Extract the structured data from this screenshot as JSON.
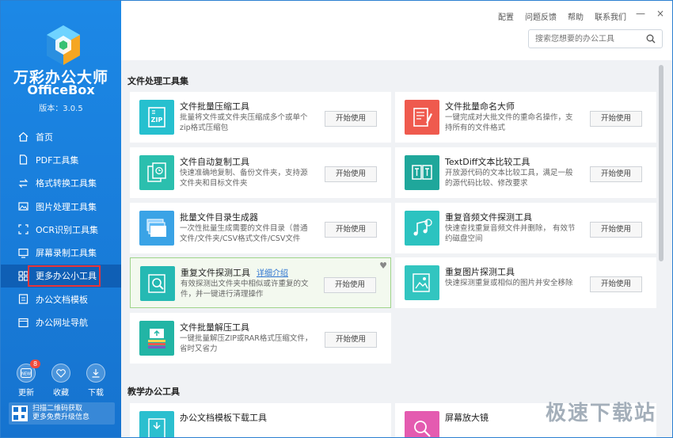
{
  "sidebar": {
    "brand_cn": "万彩办公大师",
    "brand_en": "OfficeBox",
    "version": "版本：3.0.5",
    "nav": [
      {
        "label": "首页",
        "icon": "home-icon"
      },
      {
        "label": "PDF工具集",
        "icon": "pdf-icon"
      },
      {
        "label": "格式转换工具集",
        "icon": "convert-icon"
      },
      {
        "label": "图片处理工具集",
        "icon": "image-icon"
      },
      {
        "label": "OCR识别工具集",
        "icon": "ocr-icon"
      },
      {
        "label": "屏幕录制工具集",
        "icon": "screen-record-icon"
      },
      {
        "label": "更多办公小工具",
        "icon": "grid-icon",
        "active": true
      },
      {
        "label": "办公文档模板",
        "icon": "document-template-icon"
      },
      {
        "label": "办公网址导航",
        "icon": "web-nav-icon"
      }
    ],
    "bottom": {
      "update_label": "更新",
      "update_badge": "8",
      "favorite_label": "收藏",
      "download_label": "下载"
    },
    "qr_line1": "扫描二维码获取",
    "qr_line2": "更多免费升级信息"
  },
  "topbar": {
    "links": [
      "配置",
      "问题反馈",
      "帮助",
      "联系我们"
    ],
    "min": "—",
    "close": "×",
    "search_placeholder": "搜索您想要的办公工具"
  },
  "sections": [
    {
      "title": "文件处理工具集",
      "tools": [
        {
          "name": "文件批量压缩工具",
          "desc": "批量将文件或文件夹压缩成多个或单个zip格式压缩包",
          "button": "开始使用",
          "icon": "zip-icon",
          "color": "#26c0cf"
        },
        {
          "name": "文件批量命名大师",
          "desc": "一键完成对大批文件的重命名操作，支持所有的文件格式",
          "button": "开始使用",
          "icon": "rename-icon",
          "color": "#ef5a4e"
        },
        {
          "name": "文件自动复制工具",
          "desc": "快速准确地复制、备份文件夹，支持源文件夹和目标文件夹",
          "button": "开始使用",
          "icon": "auto-copy-icon",
          "color": "#2bbfae"
        },
        {
          "name": "TextDiff文本比较工具",
          "desc": "开放源代码的文本比较工具，满足一般的源代码比较、修改要求",
          "button": "开始使用",
          "icon": "text-diff-icon",
          "color": "#1fa79b"
        },
        {
          "name": "批量文件目录生成器",
          "desc": "一次性批量生成需要的文件目录（普通文件/文件夹/CSV格式文件/CSV文件",
          "button": "开始使用",
          "icon": "directory-icon",
          "color": "#3aa3e6"
        },
        {
          "name": "重复音频文件探测工具",
          "desc": "快速查找重复音频文件并删除， 有效节约磁盘空间",
          "button": "开始使用",
          "icon": "audio-icon",
          "color": "#2cc3c0"
        },
        {
          "name": "重复文件探测工具",
          "link": "详细介绍",
          "desc": "有效探测出文件夹中相似或许重复的文件，并一键进行清理操作",
          "button": "开始使用",
          "icon": "duplicate-search-icon",
          "color": "#25b9b3",
          "selected": true
        },
        {
          "name": "重复图片探测工具",
          "desc": "快速探测重复或相似的图片并安全移除",
          "button": "开始使用",
          "icon": "duplicate-image-icon",
          "color": "#32c5c0"
        },
        {
          "name": "文件批量解压工具",
          "desc": "一键批量解压ZIP或RAR格式压缩文件，省时又省力",
          "button": "开始使用",
          "icon": "unzip-icon",
          "color": "#22b5a5"
        }
      ]
    },
    {
      "title": "教学办公工具",
      "tools": [
        {
          "name": "办公文档模板下载工具",
          "desc": "",
          "button": "",
          "icon": "template-download-icon",
          "color": "#2bbfcf"
        },
        {
          "name": "屏幕放大镜",
          "desc": "",
          "button": "",
          "icon": "magnifier-icon",
          "color": "#e45bb0"
        }
      ]
    }
  ],
  "watermark": "极速下载站"
}
